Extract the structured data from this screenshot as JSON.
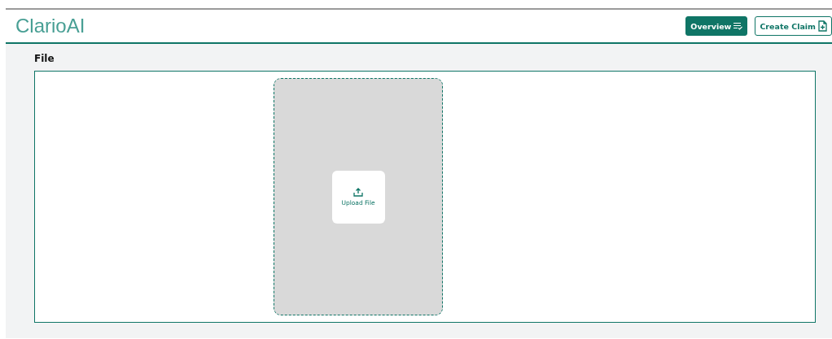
{
  "header": {
    "logo": "ClarioAI",
    "buttons": [
      {
        "label": "Overview",
        "kind": "primary"
      },
      {
        "label": "Create Claim",
        "kind": "outline"
      }
    ]
  },
  "section": {
    "title": "File",
    "upload": {
      "label": "Upload File"
    }
  }
}
